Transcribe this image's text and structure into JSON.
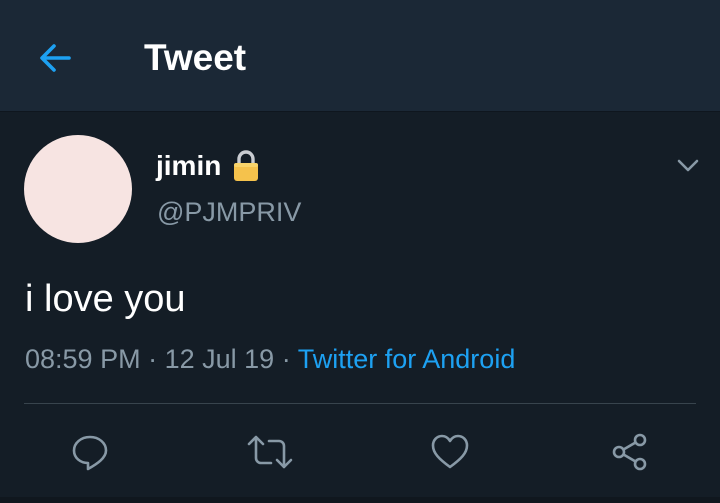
{
  "header": {
    "title": "Tweet",
    "back_icon": "arrow-left-icon"
  },
  "tweet": {
    "author": {
      "display_name": "jimin",
      "handle": "@PJMPRIV",
      "protected_icon": "lock-icon"
    },
    "text": "i love you",
    "time": "08:59 PM",
    "separator": "·",
    "date": "12 Jul 19",
    "source": "Twitter for Android",
    "menu_icon": "chevron-down-icon"
  },
  "actions": [
    {
      "name": "reply",
      "icon": "reply-icon"
    },
    {
      "name": "retweet",
      "icon": "retweet-icon"
    },
    {
      "name": "like",
      "icon": "heart-icon"
    },
    {
      "name": "share",
      "icon": "share-icon"
    }
  ],
  "colors": {
    "background": "#141d26",
    "header_bg": "#1b2836",
    "accent": "#1da1f2",
    "secondary_text": "#8899a6",
    "avatar": "#f7e4e2",
    "lock": "#f5c24c"
  }
}
